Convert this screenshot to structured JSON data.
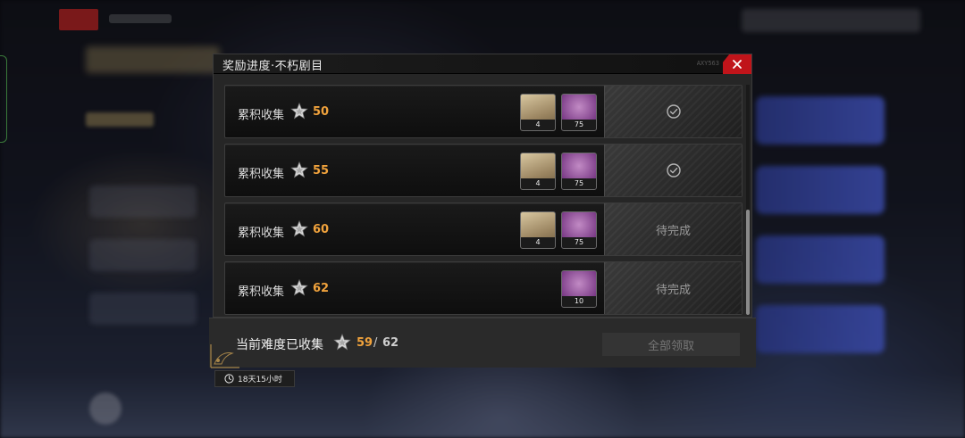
{
  "modal": {
    "title": "奖励进度·不朽剧目",
    "code": "AXY563",
    "close_icon": "close-icon"
  },
  "rows": [
    {
      "label": "累积收集",
      "count": "50",
      "rewards": [
        {
          "type": "character",
          "qty": "4"
        },
        {
          "type": "item",
          "qty": "75"
        }
      ],
      "status": "claimed",
      "status_text": ""
    },
    {
      "label": "累积收集",
      "count": "55",
      "rewards": [
        {
          "type": "character",
          "qty": "4"
        },
        {
          "type": "item",
          "qty": "75"
        }
      ],
      "status": "claimed",
      "status_text": ""
    },
    {
      "label": "累积收集",
      "count": "60",
      "rewards": [
        {
          "type": "character",
          "qty": "4"
        },
        {
          "type": "item",
          "qty": "75"
        }
      ],
      "status": "pending",
      "status_text": "待完成"
    },
    {
      "label": "累积收集",
      "count": "62",
      "rewards": [
        {
          "type": "item",
          "qty": "10"
        }
      ],
      "status": "pending",
      "status_text": "待完成"
    }
  ],
  "footer": {
    "label": "当前难度已收集",
    "current": "59",
    "separator": "/",
    "total": "62",
    "claim_all": "全部领取"
  },
  "timer": {
    "text": "18天15小时",
    "icon": "clock-icon"
  },
  "colors": {
    "accent_orange": "#f0a23c",
    "close_red": "#c0141a"
  }
}
